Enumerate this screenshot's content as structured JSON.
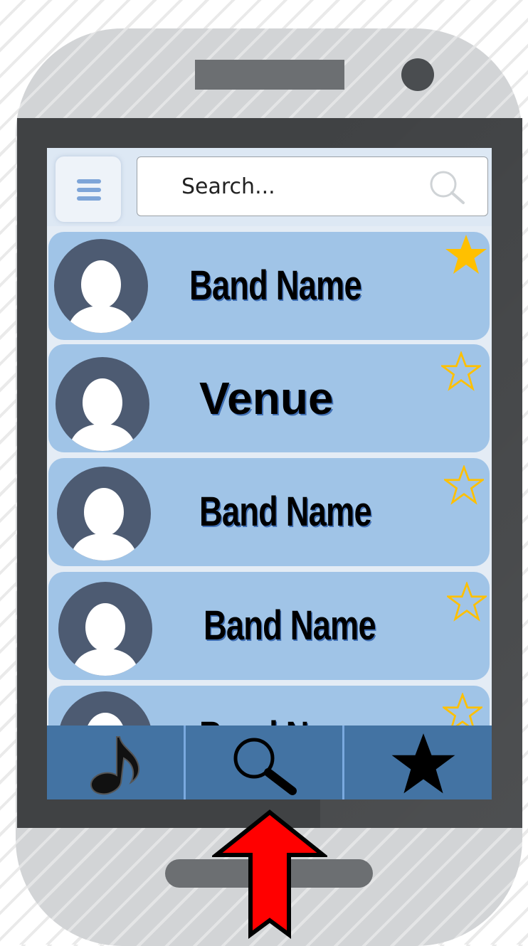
{
  "search": {
    "placeholder": "Search..."
  },
  "list": {
    "items": [
      {
        "label": "Band Name",
        "favorited": true
      },
      {
        "label": "Venue",
        "favorited": false
      },
      {
        "label": "Band Name",
        "favorited": false
      },
      {
        "label": "Band Name",
        "favorited": false
      },
      {
        "label": "Band Na",
        "favorited": false
      }
    ]
  },
  "tabs": [
    {
      "icon": "music-note-icon"
    },
    {
      "icon": "search-icon"
    },
    {
      "icon": "star-icon"
    }
  ],
  "icons": {
    "menu": "hamburger-menu-icon",
    "search": "search-icon",
    "avatar": "user-silhouette-icon",
    "favorite": "star-icon",
    "pointer": "up-arrow-icon"
  },
  "colors": {
    "card": "#a0c4e7",
    "avatar": "#4d5b72",
    "tabbar": "#4373a3",
    "star": "#ffc000",
    "arrow": "#ff0000",
    "bezel": "#404244"
  }
}
